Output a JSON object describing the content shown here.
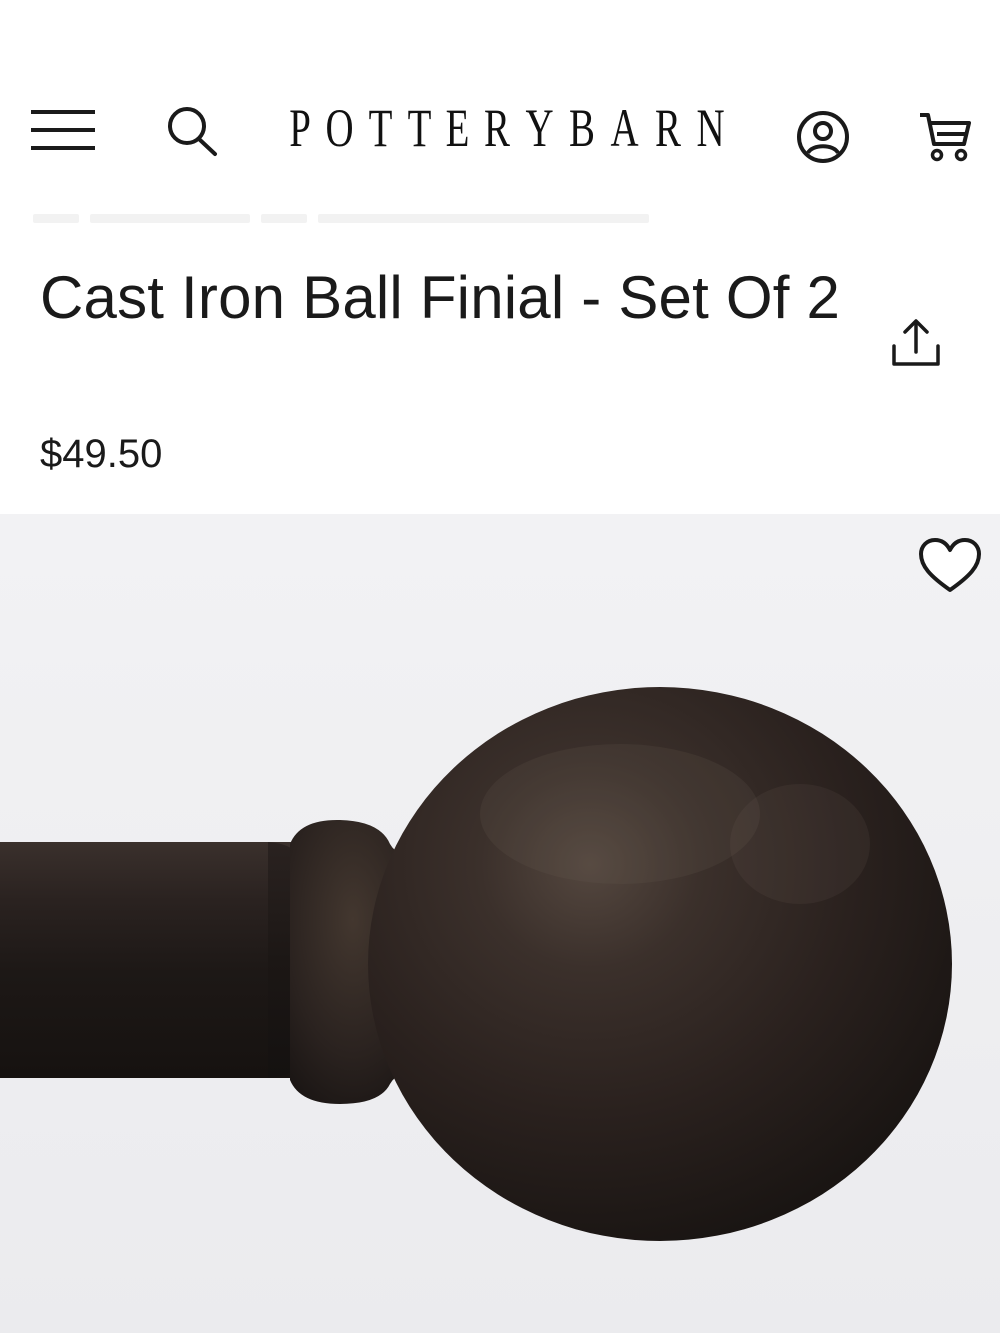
{
  "header": {
    "brand": [
      "P",
      "O",
      "T",
      "T",
      "E",
      "R",
      "Y",
      "B",
      "A",
      "R",
      "N"
    ],
    "icons": {
      "menu": "hamburger-menu-icon",
      "search": "search-icon",
      "account": "account-icon",
      "cart": "cart-icon"
    }
  },
  "product": {
    "title": "Cast Iron Ball Finial - Set Of 2",
    "price": "$49.50",
    "icons": {
      "share": "share-icon",
      "favorite": "heart-icon"
    }
  },
  "colors": {
    "text": "#1a1a1a",
    "image_background": "#f1f1f3",
    "finial": "#2b211d"
  }
}
